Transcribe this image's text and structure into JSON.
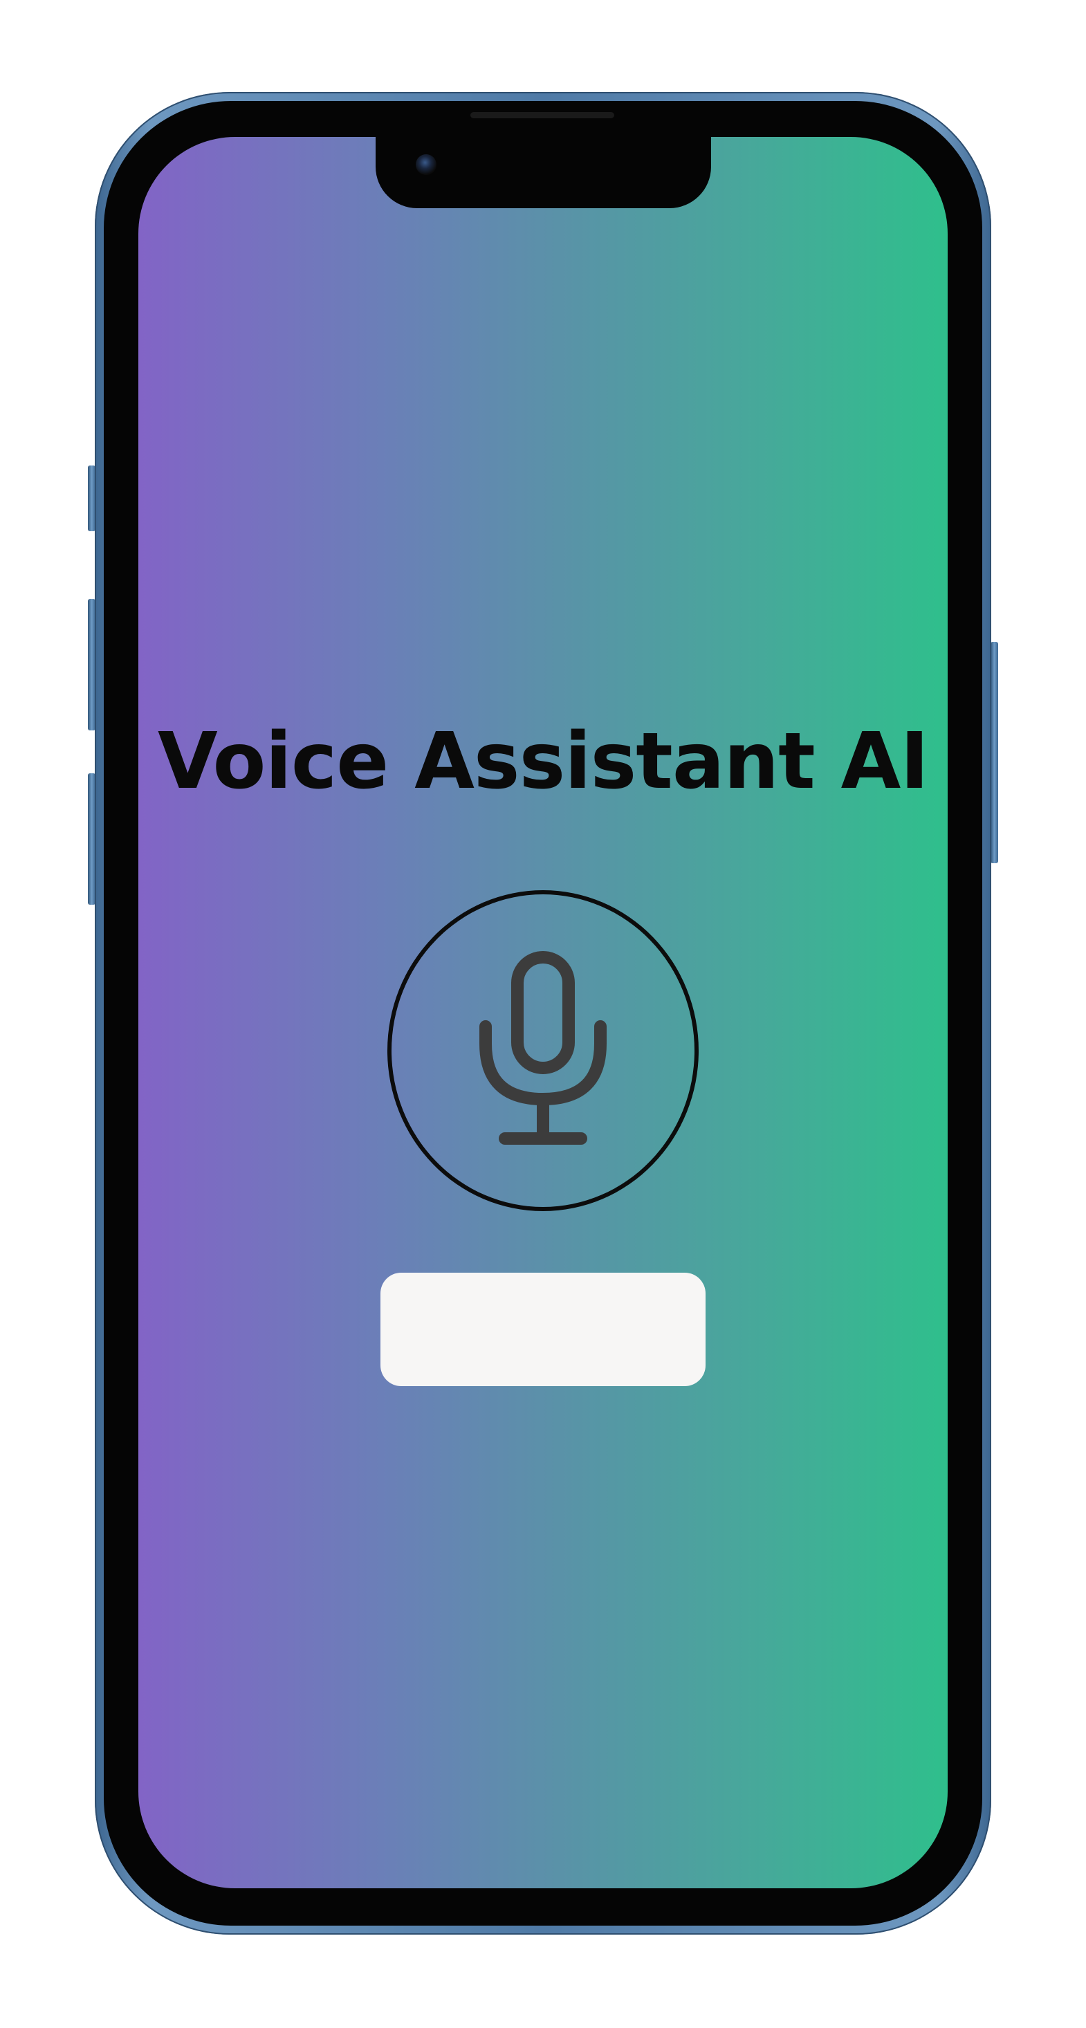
{
  "app": {
    "title": "Voice Assistant AI"
  },
  "mic_button": {
    "icon": "microphone-icon"
  },
  "input": {
    "value": "",
    "placeholder": ""
  },
  "colors": {
    "gradient_start": "#8264c6",
    "gradient_end": "#2fbf8c",
    "title_text": "#0a0a0a",
    "mic_stroke": "#3c3c3c",
    "input_background": "#f7f6f5",
    "phone_frame": "#4f7aa6"
  }
}
